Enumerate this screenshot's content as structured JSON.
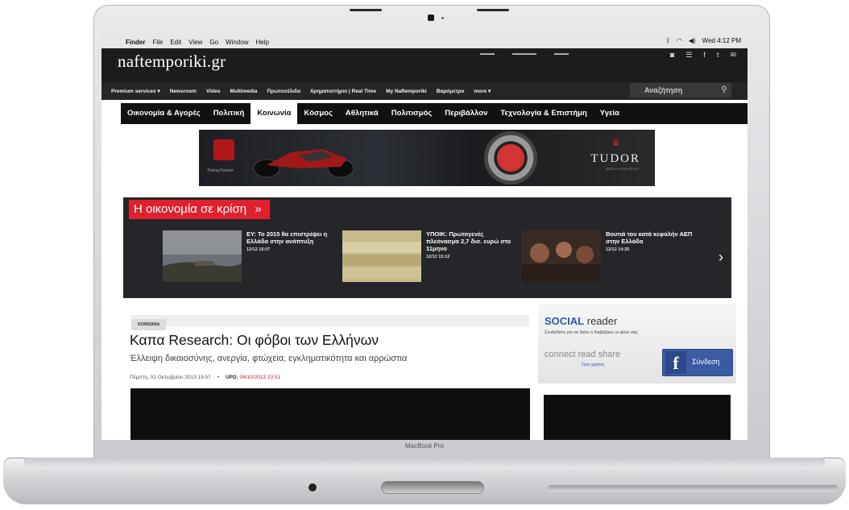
{
  "mac": {
    "menu": [
      "Finder",
      "File",
      "Edit",
      "View",
      "Go",
      "Window",
      "Help"
    ],
    "clock": "Wed 4:12 PM",
    "model_label": "MacBook Pro"
  },
  "site": {
    "logo": "naftemporiki.gr",
    "premium_nav": [
      "Premium services ▾",
      "Newsroom",
      "Video",
      "Multimedia",
      "Πρωτοσέλιδα",
      "Χρηματιστήριο | Real Time",
      "My Naftemporiki",
      "Βαρόμετρο",
      "more ▾"
    ],
    "search_placeholder": "Αναζήτηση",
    "categories": [
      "Οικονομία & Αγορές",
      "Πολιτική",
      "Κοινωνία",
      "Κόσμος",
      "Αθλητικά",
      "Πολιτισμός",
      "Περιβάλλον",
      "Τεχνολογία & Επιστήμη",
      "Υγεία"
    ],
    "active_category": "Κοινωνία"
  },
  "ad": {
    "partner": "Timing Partner",
    "brand": "TUDOR",
    "tagline": "WATCH YOUR STYLE"
  },
  "crisis": {
    "title": "Η οικονομία σε κρίση",
    "arrow": "»",
    "next": "›",
    "stories": [
      {
        "title": "ΕΥ: Το 2015 θα επιστρέψει η Ελλάδα στην ανάπτυξη",
        "date": "12/12 16:07"
      },
      {
        "title": "ΥΠΟΙΚ: Πρωτογενές πλεόνασμα 2,7 δισ. ευρώ στο 11μηνο",
        "date": "12/12 15:12"
      },
      {
        "title": "Βουτιά του κατά κεφαλήν ΑΕΠ στην Ελλάδα",
        "date": "12/12 14:25"
      }
    ]
  },
  "article": {
    "kicker": "ΚΟΙΝΩΝΙΑ",
    "headline": "Καπα Research: Οι φόβοι των Ελλήνων",
    "subhead": "Έλλειψη δικαιοσύνης, ανεργία, φτώχεια, εγκληματικότητα και αρρώστια",
    "date": "Πέμπτη, 03 Οκτωβρίου 2013 19:57",
    "upd_label": "UPD:",
    "upd_value": "04/10/2013 23:51"
  },
  "social": {
    "title_main": "SOCIAL",
    "title_rest": " reader",
    "desc": "Συνδεθείτε για να δείτε τι διαβάζουν οι φίλοι σας",
    "tags": "connect read share",
    "terms": "Όροι χρήσης",
    "button": "Σύνδεση"
  }
}
